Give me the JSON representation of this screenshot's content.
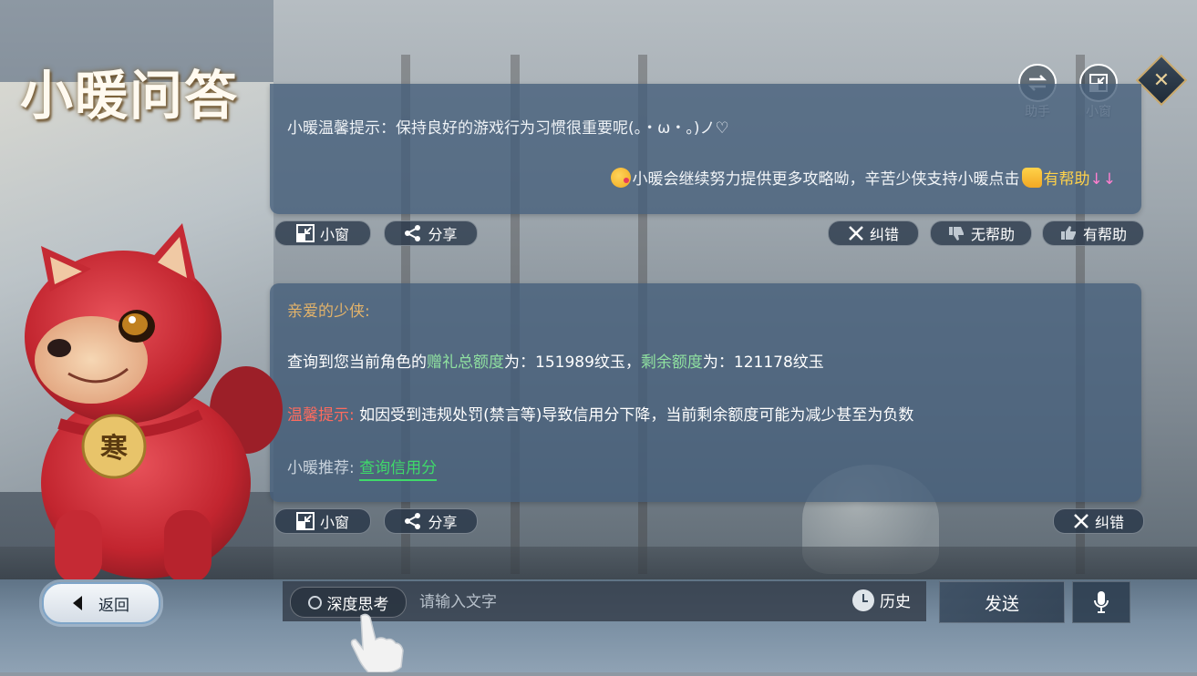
{
  "app": {
    "title": "小暖问答"
  },
  "top_buttons": {
    "assistant_label": "助手",
    "mini_window_label": "小窗"
  },
  "messages": [
    {
      "line1": "小暖温馨提示：保持良好的游戏行为习惯很重要呢(。・ω・。)ノ♡",
      "line2_prefix": "小暖会继续努力提供更多攻略呦，辛苦少侠支持小暖点击",
      "line2_helpful": "有帮助",
      "line2_arrows": "↓↓",
      "actions": {
        "mini_window": "小窗",
        "share": "分享",
        "correct": "纠错",
        "not_helpful": "无帮助",
        "helpful": "有帮助"
      }
    },
    {
      "greeting": "亲爱的少侠:",
      "query_prefix": "查询到您当前角色的",
      "gift_total_label": "赠礼总额度",
      "gift_total_value": "为：151989纹玉，",
      "remaining_label": "剩余额度",
      "remaining_value": "为：121178纹玉",
      "tip_label": "温馨提示:",
      "tip_text": "如因受到违规处罚(禁言等)导致信用分下降，当前剩余额度可能为减少甚至为负数",
      "recommend_label": "小暖推荐:",
      "recommend_link": "查询信用分",
      "actions": {
        "mini_window": "小窗",
        "share": "分享",
        "correct": "纠错"
      }
    }
  ],
  "mascot": {
    "tag_text": "寒"
  },
  "bottom": {
    "back_label": "返回",
    "deep_think_label": "深度思考",
    "input_placeholder": "请输入文字",
    "input_value": "",
    "history_label": "历史",
    "send_label": "发送"
  },
  "colors": {
    "card_bg": "#445e7a",
    "highlight_green": "#8fe0a0",
    "highlight_red": "#ff6b5e",
    "highlight_gold": "#ffd24a",
    "link_green": "#3fd96a",
    "greeting_gold": "#e3b36a"
  }
}
